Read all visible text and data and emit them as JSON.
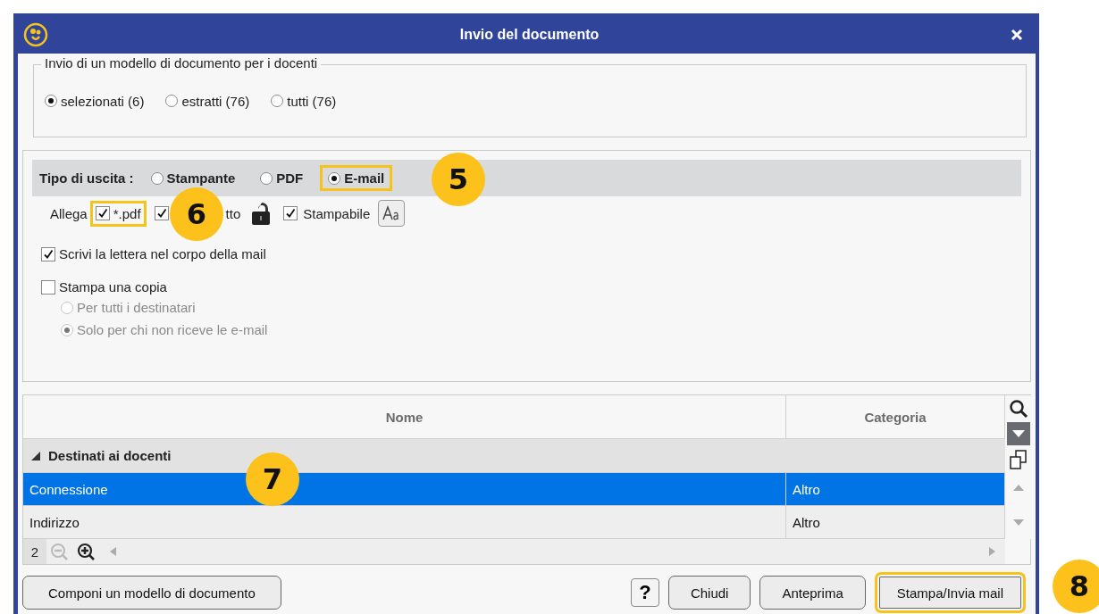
{
  "window": {
    "title": "Invio del documento"
  },
  "recipients": {
    "legend": "Invio di un modello di documento per i docenti",
    "options": [
      {
        "label": "selezionati (6)",
        "selected": true
      },
      {
        "label": "estratti (76)",
        "selected": false
      },
      {
        "label": "tutti (76)",
        "selected": false
      }
    ]
  },
  "output": {
    "label": "Tipo di uscita :",
    "options": [
      {
        "label": "Stampante",
        "selected": false,
        "highlighted": false
      },
      {
        "label": "PDF",
        "selected": false,
        "highlighted": false
      },
      {
        "label": "E-mail",
        "selected": true,
        "highlighted": true
      }
    ]
  },
  "attach": {
    "label": "Allega",
    "items": [
      {
        "label": "*.pdf",
        "checked": true,
        "highlighted": true
      },
      {
        "label": "tto",
        "checked": true,
        "highlighted": false
      },
      {
        "label": "Stampabile",
        "checked": true,
        "highlighted": false
      }
    ]
  },
  "mail_body": {
    "label": "Scrivi la lettera nel corpo della mail",
    "checked": true
  },
  "print_copy": {
    "label": "Stampa una copia",
    "checked": false,
    "options": [
      {
        "label": "Per tutti i destinatari",
        "selected": false,
        "disabled": true
      },
      {
        "label": "Solo per chi non riceve le e-mail",
        "selected": true,
        "disabled": true
      }
    ]
  },
  "table": {
    "columns": [
      "Nome",
      "Categoria"
    ],
    "groups": [
      {
        "label": "Destinati ai docenti",
        "expanded": true,
        "rows": [
          {
            "cells": [
              "Connessione",
              "Altro"
            ],
            "selected": true
          },
          {
            "cells": [
              "Indirizzo",
              "Altro"
            ],
            "selected": false
          }
        ]
      }
    ],
    "count": "2"
  },
  "help": "?",
  "buttons": [
    {
      "label": "Componi un modello di documento",
      "highlighted": false
    },
    {
      "label": "Chiudi",
      "highlighted": false
    },
    {
      "label": "Anteprima",
      "highlighted": false
    },
    {
      "label": "Stampa/Invia mail",
      "highlighted": true
    }
  ],
  "callouts": [
    {
      "number": "5"
    },
    {
      "number": "6"
    },
    {
      "number": "7"
    },
    {
      "number": "8"
    }
  ]
}
